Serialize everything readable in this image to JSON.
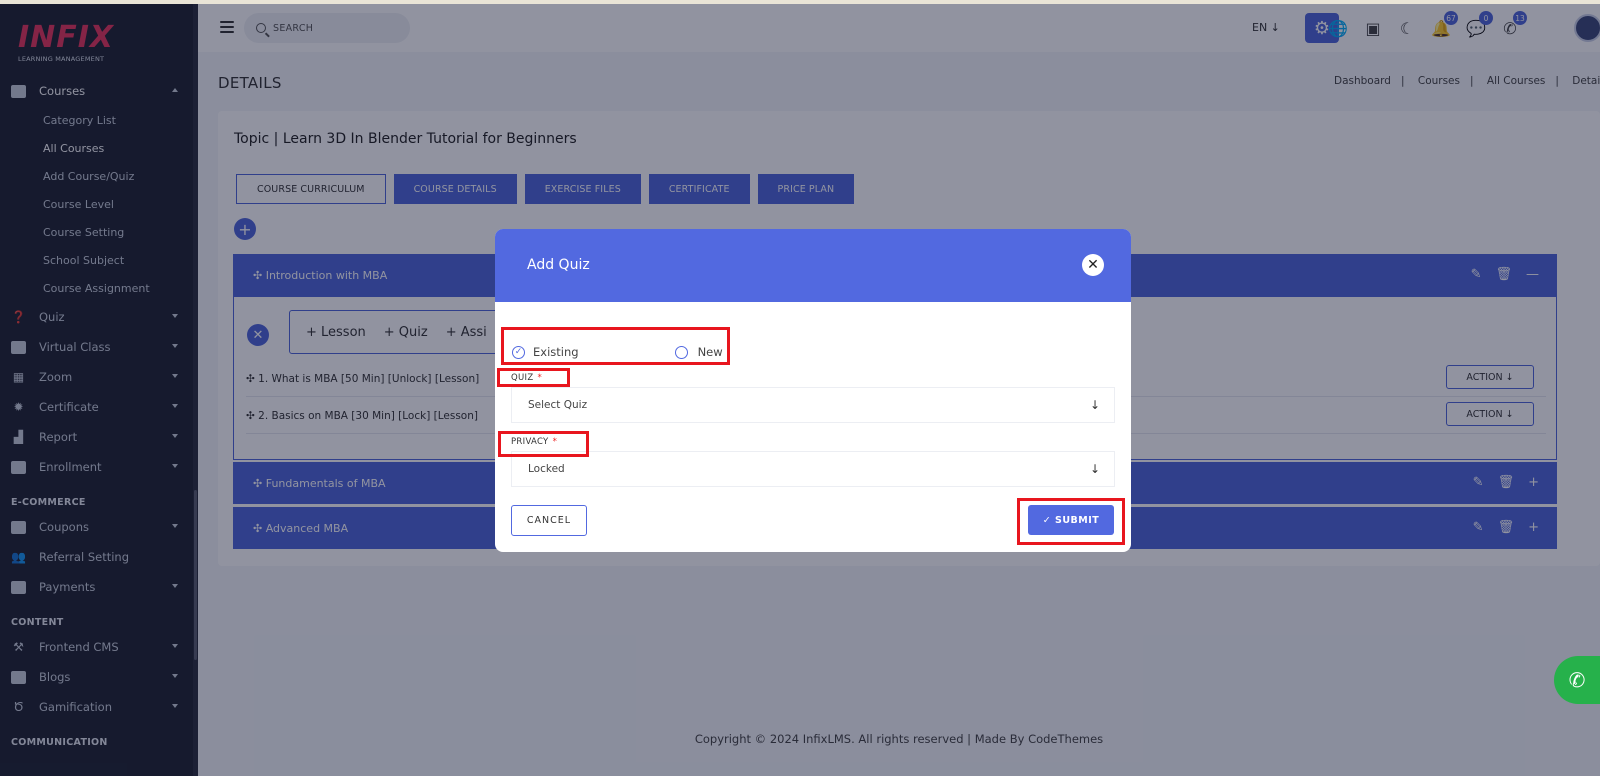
{
  "brand": {
    "logo": "INFIX",
    "tagline": "LEARNING MANAGEMENT"
  },
  "sidebar": {
    "items": [
      {
        "label": "Courses",
        "icon": "book-icon",
        "active": true,
        "expanded": true
      },
      {
        "label": "Category List",
        "sub": true
      },
      {
        "label": "All Courses",
        "sub": true,
        "active": true
      },
      {
        "label": "Add Course/Quiz",
        "sub": true
      },
      {
        "label": "Course Level",
        "sub": true
      },
      {
        "label": "Course Setting",
        "sub": true
      },
      {
        "label": "School Subject",
        "sub": true
      },
      {
        "label": "Course Assignment",
        "sub": true
      },
      {
        "label": "Quiz",
        "icon": "question-icon"
      },
      {
        "label": "Virtual Class",
        "icon": "vr-icon"
      },
      {
        "label": "Zoom",
        "icon": "grid-icon"
      },
      {
        "label": "Certificate",
        "icon": "certificate-icon"
      },
      {
        "label": "Report",
        "icon": "chart-icon"
      },
      {
        "label": "Enrollment",
        "icon": "enrollment-icon"
      },
      {
        "heading": "E-COMMERCE"
      },
      {
        "label": "Coupons",
        "icon": "ticket-icon"
      },
      {
        "label": "Referral Setting",
        "icon": "users-icon"
      },
      {
        "label": "Payments",
        "icon": "money-icon"
      },
      {
        "heading": "CONTENT"
      },
      {
        "label": "Frontend CMS",
        "icon": "paint-roller-icon"
      },
      {
        "label": "Blogs",
        "icon": "pencil-square-icon"
      },
      {
        "label": "Gamification",
        "icon": "medal-icon"
      },
      {
        "heading": "COMMUNICATION"
      }
    ]
  },
  "topbar": {
    "search_placeholder": "SEARCH",
    "language": "EN",
    "badges": {
      "notifications": "67",
      "messages": "0",
      "whatsapp": "13"
    }
  },
  "page": {
    "title": "DETAILS",
    "breadcrumb": [
      "Dashboard",
      "Courses",
      "All Courses",
      "Details"
    ],
    "topic_title": "Topic | Learn 3D In Blender Tutorial for Beginners",
    "tabs": [
      "COURSE CURRICULUM",
      "COURSE DETAILS",
      "EXERCISE FILES",
      "CERTIFICATE",
      "PRICE PLAN"
    ],
    "add_options": [
      "+ Lesson",
      "+ Quiz",
      "+ Assi"
    ],
    "sections": [
      {
        "title": "✣ Introduction with MBA"
      },
      {
        "title": "✣ Fundamentals of MBA"
      },
      {
        "title": "✣ Advanced MBA"
      }
    ],
    "lessons": [
      {
        "title": "✣ 1. What is MBA [50 Min] [Unlock] [Lesson]",
        "action": "ACTION"
      },
      {
        "title": "✣ 2. Basics on MBA [30 Min] [Lock] [Lesson]",
        "action": "ACTION"
      }
    ],
    "footer": "Copyright © 2024 InfixLMS. All rights reserved | Made By CodeThemes"
  },
  "modal": {
    "title": "Add Quiz",
    "option_existing": "Existing",
    "option_new": "New",
    "quiz_label": "QUIZ",
    "quiz_value": "Select Quiz",
    "privacy_label": "PRIVACY",
    "privacy_value": "Locked",
    "required_mark": "*",
    "cancel": "CANCEL",
    "submit": "SUBMIT"
  },
  "colors": {
    "accent": "#5269e0",
    "sidebar": "#1f2431",
    "brand": "#e8355b",
    "highlight": "#e8161e",
    "whatsapp": "#26b14b"
  }
}
